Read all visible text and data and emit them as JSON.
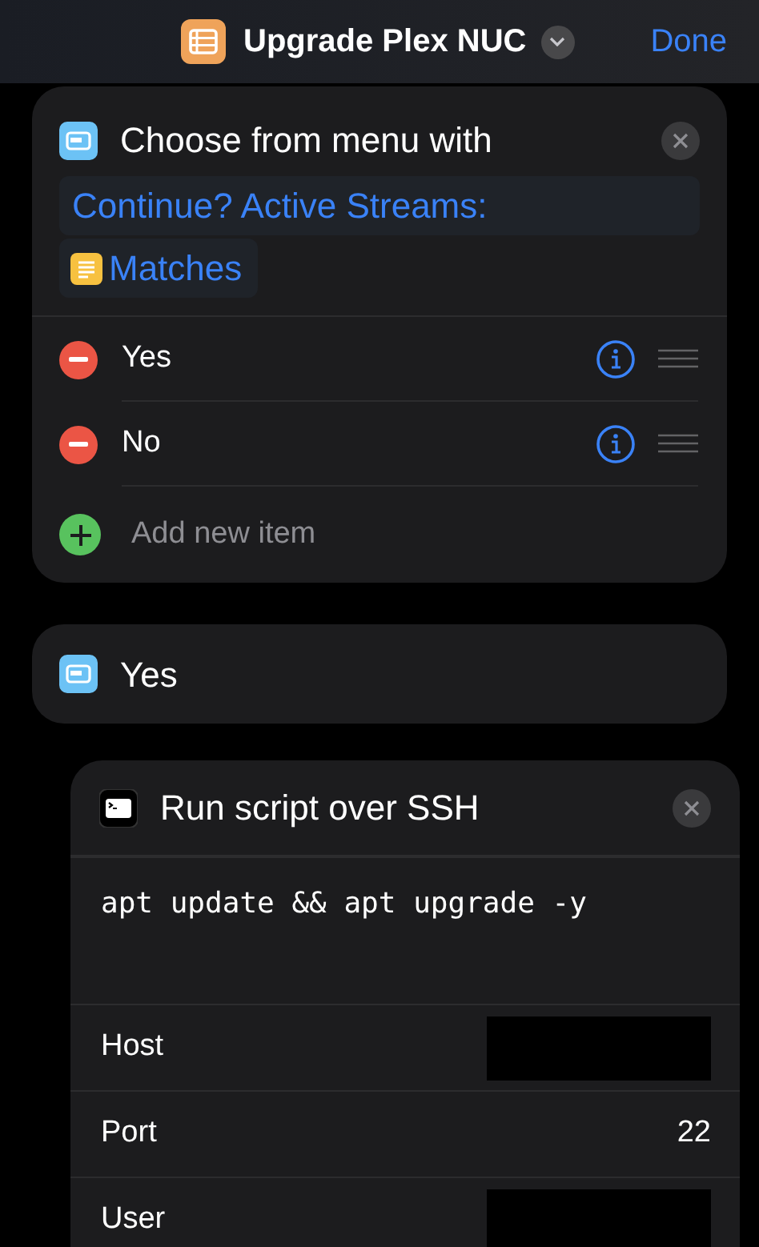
{
  "header": {
    "title": "Upgrade Plex NUC",
    "done": "Done"
  },
  "menu_action": {
    "title": "Choose from menu with",
    "prompt": "Continue? Active Streams:",
    "variable": "Matches",
    "items": [
      {
        "label": "Yes"
      },
      {
        "label": "No"
      }
    ],
    "add_item": "Add new item"
  },
  "case_block": {
    "title": "Yes"
  },
  "ssh_action": {
    "title": "Run script over SSH",
    "script": "apt update && apt upgrade -y",
    "fields": [
      {
        "label": "Host",
        "redacted": true
      },
      {
        "label": "Port",
        "value": "22",
        "redacted": false
      },
      {
        "label": "User",
        "redacted": true
      }
    ]
  }
}
